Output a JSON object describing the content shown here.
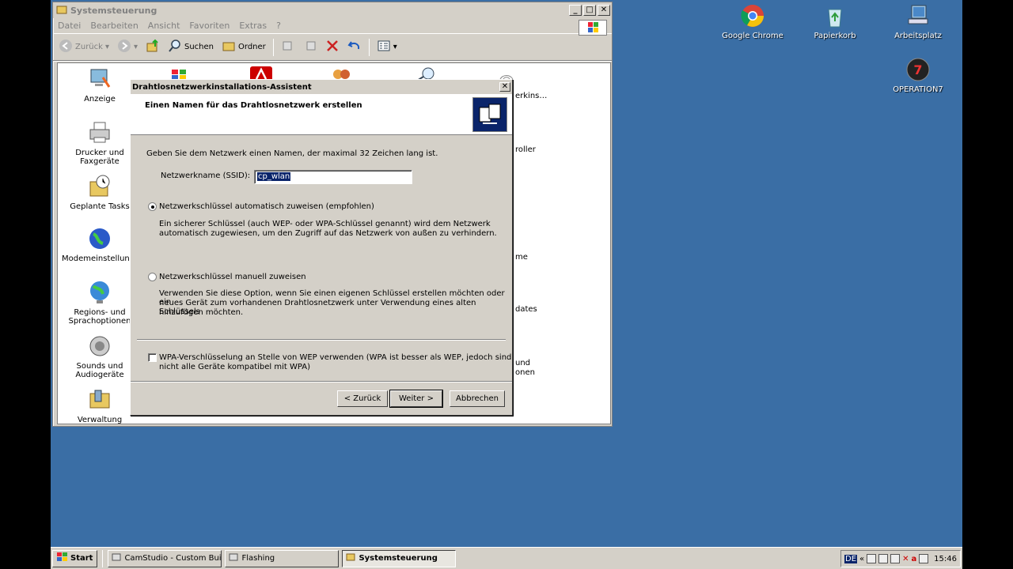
{
  "desktop": {
    "icons": [
      {
        "label": "Google Chrome",
        "icon": "chrome-icon"
      },
      {
        "label": "Papierkorb",
        "icon": "recycle-bin-icon"
      },
      {
        "label": "Arbeitsplatz",
        "icon": "my-computer-icon"
      },
      {
        "label": "OPERATION7",
        "icon": "operation7-icon"
      }
    ]
  },
  "control_panel": {
    "title": "Systemsteuerung",
    "menu": [
      "Datei",
      "Bearbeiten",
      "Ansicht",
      "Favoriten",
      "Extras",
      "?"
    ],
    "toolbar": {
      "back": "Zurück",
      "search": "Suchen",
      "folders": "Ordner"
    },
    "items": [
      {
        "label": "Anzeige"
      },
      {
        "label": "Drucker und Faxgeräte"
      },
      {
        "label": "Geplante Tasks"
      },
      {
        "label": "Modemeinstellungen"
      },
      {
        "label": "Regions- und Sprachoptionen"
      },
      {
        "label": "Sounds und Audiogeräte"
      },
      {
        "label": "Verwaltung"
      }
    ],
    "partial_labels": [
      "erkins…",
      "roller",
      "me",
      "dates",
      "und",
      "onen"
    ]
  },
  "wizard": {
    "title": "Drahtlosnetzwerkinstallations-Assistent",
    "heading": "Einen Namen für das Drahtlosnetzwerk erstellen",
    "intro": "Geben Sie dem Netzwerk einen Namen, der maximal 32 Zeichen lang ist.",
    "ssid_label": "Netzwerkname (SSID):",
    "ssid_value": "cp_wlan",
    "option_auto": "Netzwerkschlüssel automatisch zuweisen (empfohlen)",
    "option_auto_desc_1": "Ein sicherer Schlüssel (auch WEP- oder WPA-Schlüssel genannt) wird dem Netzwerk",
    "option_auto_desc_2": "automatisch zugewiesen, um den Zugriff auf das Netzwerk von außen zu verhindern.",
    "option_manual": "Netzwerkschlüssel manuell zuweisen",
    "option_manual_desc_1": "Verwenden Sie diese Option, wenn Sie einen eigenen Schlüssel erstellen möchten oder ein",
    "option_manual_desc_2": "neues Gerät zum vorhandenen Drahtlosnetzwerk unter Verwendung eines alten Schlüssels",
    "option_manual_desc_3": "hinzufügen möchten.",
    "wpa_1": "WPA-Verschlüsselung an Stelle von WEP verwenden (WPA ist besser als WEP, jedoch sind",
    "wpa_2": "nicht alle Geräte kompatibel mit WPA)",
    "selected_option": "auto",
    "wpa_checked": false,
    "buttons": {
      "back": "< Zurück",
      "next": "Weiter >",
      "cancel": "Abbrechen"
    }
  },
  "taskbar": {
    "start": "Start",
    "tasks": [
      {
        "label": "CamStudio - Custom Build",
        "active": false
      },
      {
        "label": "Flashing",
        "active": false
      },
      {
        "label": "Systemsteuerung",
        "active": true
      }
    ],
    "language": "DE",
    "chevron": "«",
    "clock": "15:46"
  },
  "colors": {
    "desktop": "#3a6ea5",
    "selection": "#0a246a"
  }
}
